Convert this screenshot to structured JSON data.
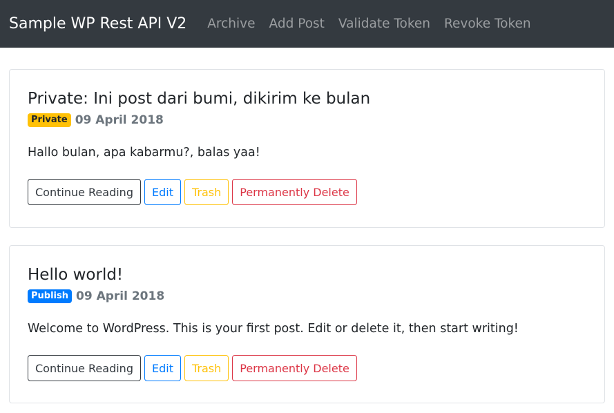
{
  "navbar": {
    "brand": "Sample WP Rest API V2",
    "links": [
      "Archive",
      "Add Post",
      "Validate Token",
      "Revoke Token"
    ]
  },
  "posts": [
    {
      "title": "Private: Ini post dari bumi, dikirim ke bulan",
      "status": "Private",
      "date": "09 April 2018",
      "excerpt": "Hallo bulan, apa kabarmu?, balas yaa!",
      "actions": [
        "Continue Reading",
        "Edit",
        "Trash",
        "Permanently Delete"
      ]
    },
    {
      "title": "Hello world!",
      "status": "Publish",
      "date": "09 April 2018",
      "excerpt": "Welcome to WordPress. This is your first post. Edit or delete it, then start writing!",
      "actions": [
        "Continue Reading",
        "Edit",
        "Trash",
        "Permanently Delete"
      ]
    }
  ],
  "colors": {
    "navbar_bg": "#343a40",
    "private_badge": "#ffc107",
    "publish_badge": "#007bff",
    "danger": "#dc3545"
  }
}
